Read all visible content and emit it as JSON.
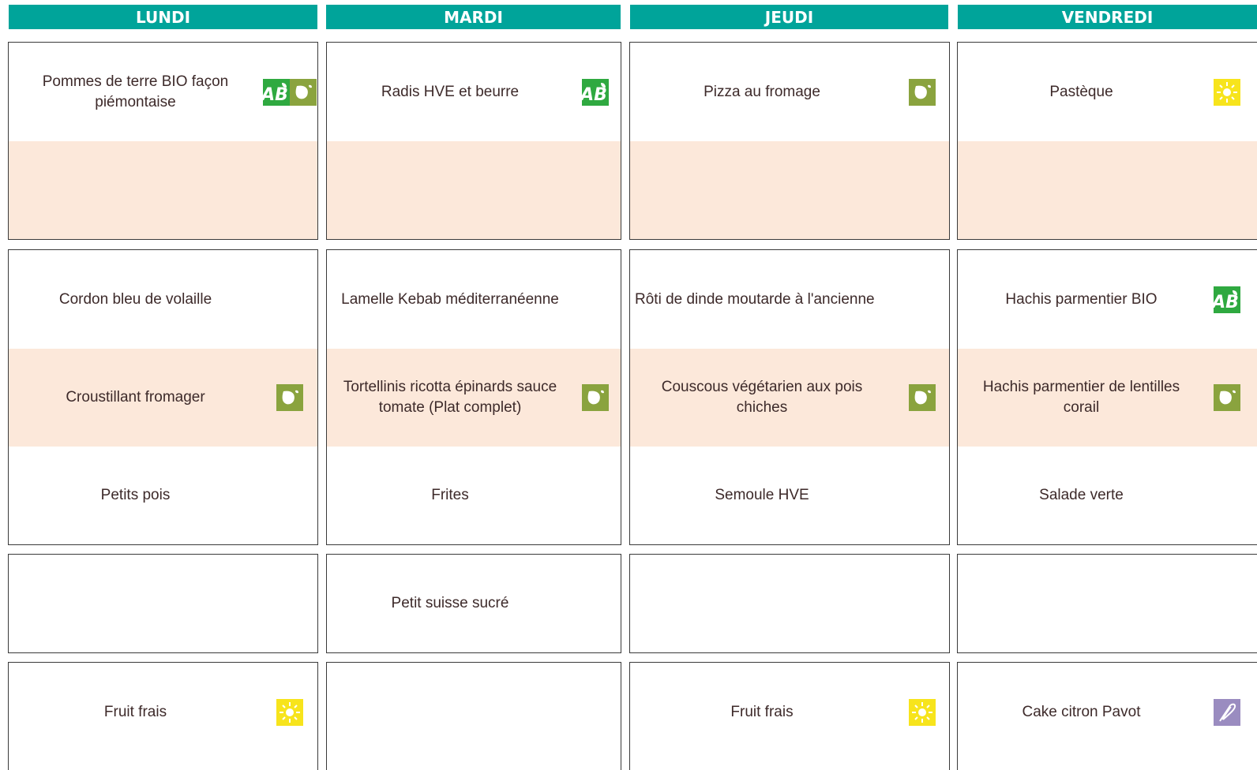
{
  "days": [
    {
      "label": "LUNDI"
    },
    {
      "label": "MARDI"
    },
    {
      "label": "JEUDI"
    },
    {
      "label": "VENDREDI"
    }
  ],
  "menu": {
    "lundi": {
      "entree_main": "Pommes de terre BIO façon\npiémontaise",
      "plat_main": "Cordon bleu de volaille",
      "plat_alt": "Croustillant fromager",
      "garniture": "Petits pois",
      "laitage": "",
      "dessert": "Fruit frais"
    },
    "mardi": {
      "entree_main": "Radis HVE et beurre",
      "plat_main": "Lamelle Kebab méditerranéenne",
      "plat_alt": "Tortellinis ricotta épinards sauce\ntomate (Plat complet)",
      "garniture": "Frites",
      "laitage": "Petit suisse sucré",
      "dessert": ""
    },
    "jeudi": {
      "entree_main": "Pizza au fromage",
      "plat_main": "Rôti de dinde moutarde à l'ancienne",
      "plat_alt": "Couscous végétarien aux pois\nchiches",
      "garniture": "Semoule HVE",
      "laitage": "",
      "dessert": "Fruit frais"
    },
    "vendredi": {
      "entree_main": "Pastèque",
      "plat_main": "Hachis parmentier BIO",
      "plat_alt": "Hachis parmentier de lentilles\ncorail",
      "garniture": "Salade verte",
      "laitage": "",
      "dessert": "Cake citron Pavot"
    }
  },
  "badges": {
    "organic": "AB",
    "names": [
      "organic-ab-icon",
      "vegetarian-leaf-icon",
      "seasonal-sun-icon",
      "homemade-whisk-icon"
    ]
  },
  "colors": {
    "header": "#00a49a",
    "peach": "#fce8da",
    "organic": "#2fa940",
    "vegetarian": "#8aa33e",
    "seasonal": "#f7e41c",
    "homemade": "#9a8cc0"
  }
}
